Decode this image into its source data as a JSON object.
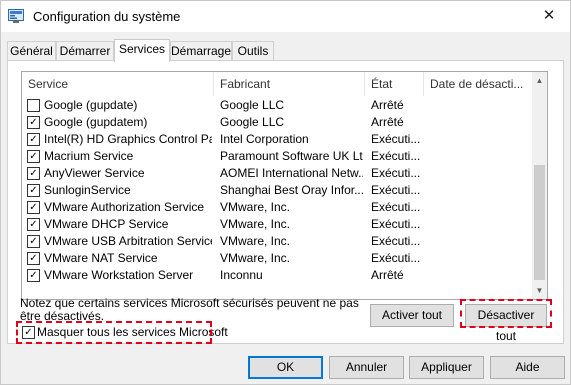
{
  "window": {
    "title": "Configuration du système",
    "close_glyph": "✕"
  },
  "tabs": [
    {
      "label": "Général"
    },
    {
      "label": "Démarrer"
    },
    {
      "label": "Services"
    },
    {
      "label": "Démarrage"
    },
    {
      "label": "Outils"
    }
  ],
  "active_tab": "Services",
  "services_list": {
    "sort_indicator": "^",
    "columns": [
      "Service",
      "Fabricant",
      "État",
      "Date de désacti..."
    ],
    "rows": [
      {
        "checked": false,
        "service": "Google (gupdate)",
        "manufacturer": "Google LLC",
        "state": "Arrêté"
      },
      {
        "checked": true,
        "service": "Google (gupdatem)",
        "manufacturer": "Google LLC",
        "state": "Arrêté"
      },
      {
        "checked": true,
        "service": "Intel(R) HD Graphics Control Pa...",
        "manufacturer": "Intel Corporation",
        "state": "Exécuti..."
      },
      {
        "checked": true,
        "service": "Macrium Service",
        "manufacturer": "Paramount Software UK Ltd",
        "state": "Exécuti..."
      },
      {
        "checked": true,
        "service": "AnyViewer Service",
        "manufacturer": "AOMEI International Netw...",
        "state": "Exécuti..."
      },
      {
        "checked": true,
        "service": "SunloginService",
        "manufacturer": "Shanghai Best Oray Infor...",
        "state": "Exécuti..."
      },
      {
        "checked": true,
        "service": "VMware Authorization Service",
        "manufacturer": "VMware, Inc.",
        "state": "Exécuti..."
      },
      {
        "checked": true,
        "service": "VMware DHCP Service",
        "manufacturer": "VMware, Inc.",
        "state": "Exécuti..."
      },
      {
        "checked": true,
        "service": "VMware USB Arbitration Service",
        "manufacturer": "VMware, Inc.",
        "state": "Exécuti..."
      },
      {
        "checked": true,
        "service": "VMware NAT Service",
        "manufacturer": "VMware, Inc.",
        "state": "Exécuti..."
      },
      {
        "checked": true,
        "service": "VMware Workstation Server",
        "manufacturer": "Inconnu",
        "state": "Arrêté"
      }
    ],
    "scroll_up_glyph": "▲",
    "scroll_down_glyph": "▼"
  },
  "note": "Notez que certains services Microsoft sécurisés peuvent ne pas être désactivés.",
  "buttons": {
    "enable_all": "Activer tout",
    "disable_all": "Désactiver tout",
    "ok": "OK",
    "cancel": "Annuler",
    "apply": "Appliquer",
    "help": "Aide"
  },
  "hide_microsoft": {
    "checked": true,
    "label": "Masquer tous les services Microsoft"
  },
  "colors": {
    "highlight": "#e0001b",
    "primary_button_border": "#0078d7"
  }
}
